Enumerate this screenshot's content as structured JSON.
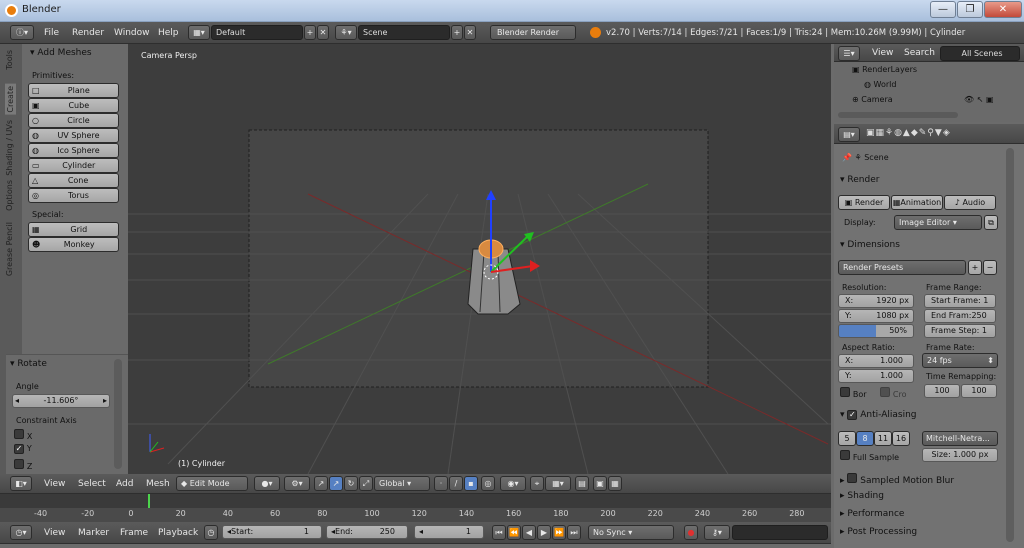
{
  "window": {
    "title": "Blender",
    "min_label": "—",
    "max_label": "❐",
    "close_label": "✕"
  },
  "info_header": {
    "menus": [
      "File",
      "Render",
      "Window",
      "Help"
    ],
    "layout": "Default",
    "scene": "Scene",
    "engine": "Blender Render",
    "stats": "v2.70 | Verts:7/14 | Edges:7/21 | Faces:1/9 | Tris:24 | Mem:10.26M (9.99M) | Cylinder"
  },
  "toolshelf": {
    "tabs": [
      "Tools",
      "Create",
      "Shading / UVs",
      "Options",
      "Grease Pencil"
    ],
    "panel_title": "Add Meshes",
    "primitives_label": "Primitives:",
    "primitives": [
      "Plane",
      "Cube",
      "Circle",
      "UV Sphere",
      "Ico Sphere",
      "Cylinder",
      "Cone",
      "Torus"
    ],
    "special_label": "Special:",
    "special": [
      "Grid",
      "Monkey"
    ],
    "operator_title": "Rotate",
    "angle_label": "Angle",
    "angle_value": "-11.606°",
    "constraint_label": "Constraint Axis",
    "axes": [
      {
        "label": "X",
        "checked": false
      },
      {
        "label": "Y",
        "checked": true
      },
      {
        "label": "Z",
        "checked": false
      }
    ]
  },
  "viewport": {
    "view_name": "Camera Persp",
    "object_label": "(1) Cylinder",
    "menus": [
      "View",
      "Select",
      "Add",
      "Mesh"
    ],
    "mode": "Edit Mode",
    "orientation": "Global"
  },
  "timeline": {
    "ticks": [
      "-40",
      "-20",
      "0",
      "20",
      "40",
      "60",
      "80",
      "100",
      "120",
      "140",
      "160",
      "180",
      "200",
      "220",
      "240",
      "260",
      "280"
    ],
    "menus": [
      "View",
      "Marker",
      "Frame",
      "Playback"
    ],
    "start": "Start:",
    "start_val": "1",
    "end": "End:",
    "end_val": "250",
    "current": "1",
    "sync": "No Sync"
  },
  "outliner": {
    "menus": [
      "View",
      "Search"
    ],
    "filter": "All Scenes",
    "items": [
      "RenderLayers",
      "World",
      "Camera"
    ]
  },
  "properties": {
    "context": "Scene",
    "render_title": "Render",
    "render_btn": "Render",
    "anim_btn": "Animation",
    "audio_btn": "Audio",
    "display_label": "Display:",
    "display_value": "Image Editor",
    "dimensions_title": "Dimensions",
    "presets": "Render Presets",
    "resolution_label": "Resolution:",
    "res_x": "X:",
    "res_x_val": "1920 px",
    "res_y": "Y:",
    "res_y_val": "1080 px",
    "res_pct": "50%",
    "frame_range_label": "Frame Range:",
    "start_frame": "Start Frame: 1",
    "end_frame": "End Fram:250",
    "frame_step": "Frame Step: 1",
    "aspect_label": "Aspect Ratio:",
    "asp_x": "X:",
    "asp_x_val": "1.000",
    "asp_y": "Y:",
    "asp_y_val": "1.000",
    "frame_rate_label": "Frame Rate:",
    "fps": "24 fps",
    "time_remap_label": "Time Remapping:",
    "remap_old": "100",
    "remap_new": "100",
    "bor": "Bor",
    "cro": "Cro",
    "aa_title": "Anti-Aliasing",
    "aa_samples": [
      "5",
      "8",
      "11",
      "16"
    ],
    "aa_filter": "Mitchell-Netra...",
    "full_sample": "Full Sample",
    "size": "Size: 1.000 px",
    "collapsed": [
      "Sampled Motion Blur",
      "Shading",
      "Performance",
      "Post Processing"
    ]
  }
}
